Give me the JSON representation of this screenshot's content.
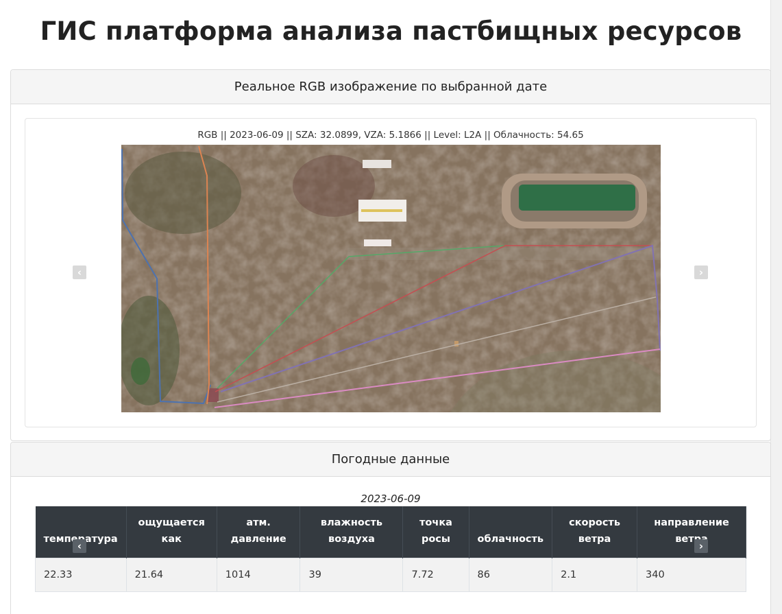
{
  "page": {
    "title": "ГИС платформа анализа пастбищных ресурсов"
  },
  "rgb_card": {
    "header": "Реальное RGB изображение по выбранной дате",
    "caption": "RGB || 2023-06-09 || SZA: 32.0899, VZA: 5.1866 || Level: L2A || Облачность: 54.65",
    "prev_icon": "chevron-left-icon",
    "next_icon": "chevron-right-icon",
    "prev_glyph": "‹",
    "next_glyph": "›",
    "polygon_colors": [
      "#4c72b0",
      "#dd8452",
      "#55a868",
      "#c44e52",
      "#8172b2",
      "#937860",
      "#da8bc3"
    ]
  },
  "weather_card": {
    "header": "Погодные данные",
    "date": "2023-06-09",
    "columns": [
      [
        "температура"
      ],
      [
        "ощущается",
        "как"
      ],
      [
        "атм.",
        "давление"
      ],
      [
        "влажность",
        "воздуха"
      ],
      [
        "точка",
        "росы"
      ],
      [
        "облачность"
      ],
      [
        "скорость",
        "ветра"
      ],
      [
        "направление",
        "ветра"
      ]
    ],
    "row": [
      "22.33",
      "21.64",
      "1014",
      "39",
      "7.72",
      "86",
      "2.1",
      "340"
    ],
    "prev_glyph": "‹",
    "next_glyph": "›"
  }
}
